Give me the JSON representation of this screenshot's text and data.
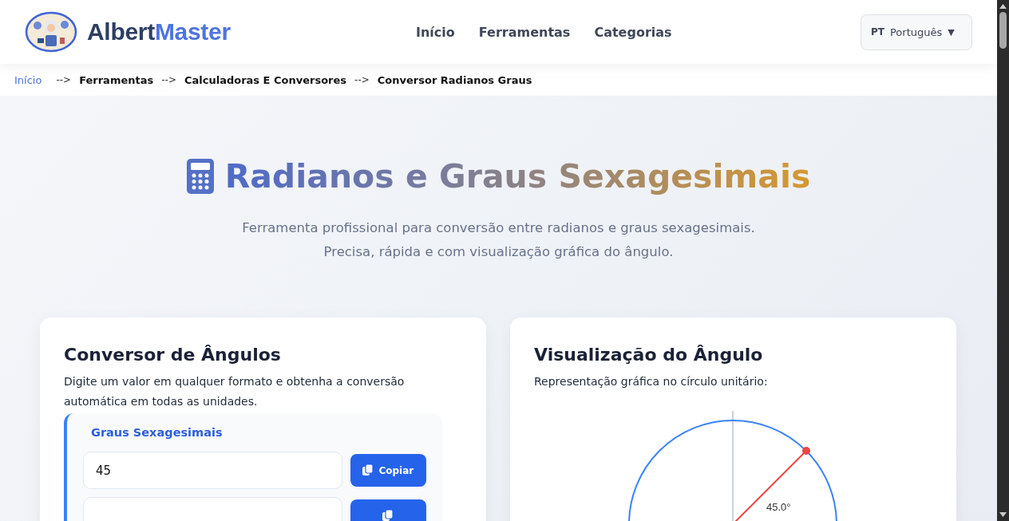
{
  "header": {
    "brand": [
      {
        "text": "Albert",
        "kind": "dark"
      },
      {
        "text": "Master",
        "kind": "accent"
      }
    ],
    "nav": [
      {
        "label": "Início"
      },
      {
        "label": "Ferramentas"
      },
      {
        "label": "Categorias"
      }
    ],
    "language": {
      "code": "PT",
      "label": "Português",
      "caret": "▼"
    }
  },
  "breadcrumb": [
    {
      "label": "Início",
      "link": true
    },
    {
      "label": "Ferramentas",
      "link": false
    },
    {
      "label": "Calculadoras E Conversores",
      "link": false
    },
    {
      "label": "Conversor Radianos Graus",
      "link": false
    }
  ],
  "breadcrumb_separator": "-->",
  "hero": {
    "title": "Radianos e Graus Sexagesimais",
    "subtitle_lines": [
      "Ferramenta profissional para conversão entre radianos e graus sexagesimais.",
      "Precisa, rápida e com visualização gráfica do ângulo."
    ]
  },
  "converter": {
    "title": "Conversor de Ângulos",
    "description": "Digite um valor em qualquer formato e obtenha a conversão automática em todas as unidades.",
    "group_label": "Graus Sexagesimais",
    "rows": [
      {
        "value": "45",
        "button": "Copiar"
      },
      {}
    ]
  },
  "visualization": {
    "title": "Visualização do Ângulo",
    "description": "Representação gráfica no círculo unitário:",
    "angle_label": "45.0°"
  }
}
